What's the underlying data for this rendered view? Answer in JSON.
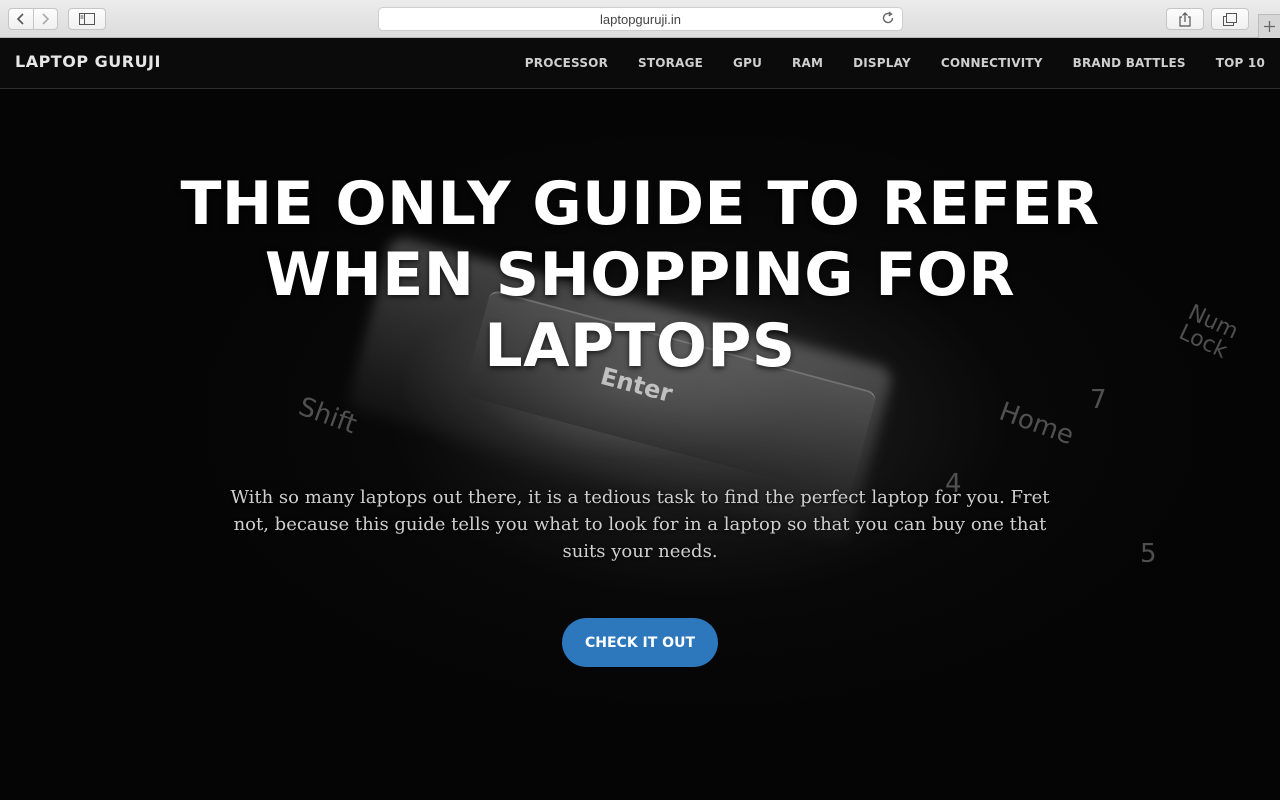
{
  "browser": {
    "url": "laptopguruji.in",
    "icons": [
      "back-icon",
      "forward-icon",
      "sidebar-icon",
      "reload-icon",
      "share-icon",
      "tabs-icon",
      "new-tab-icon"
    ]
  },
  "site": {
    "brand": "LAPTOP GURUJI",
    "nav": [
      "PROCESSOR",
      "STORAGE",
      "GPU",
      "RAM",
      "DISPLAY",
      "CONNECTIVITY",
      "BRAND BATTLES",
      "TOP 10"
    ]
  },
  "hero": {
    "title": "THE ONLY GUIDE TO REFER WHEN SHOPPING FOR LAPTOPS",
    "subtitle": "With so many laptops out there, it is a tedious task to find the perfect laptop for you. Fret not, because this guide tells you what to look for in a laptop so that you can buy one that suits your needs.",
    "cta": "CHECK IT OUT",
    "cta_color": "#2d77bd"
  },
  "background_keys": {
    "enter": "Enter",
    "shift": "Shift",
    "home": "Home",
    "numlock": "Num Lock",
    "num7": "7",
    "num4": "4",
    "num5": "5"
  }
}
